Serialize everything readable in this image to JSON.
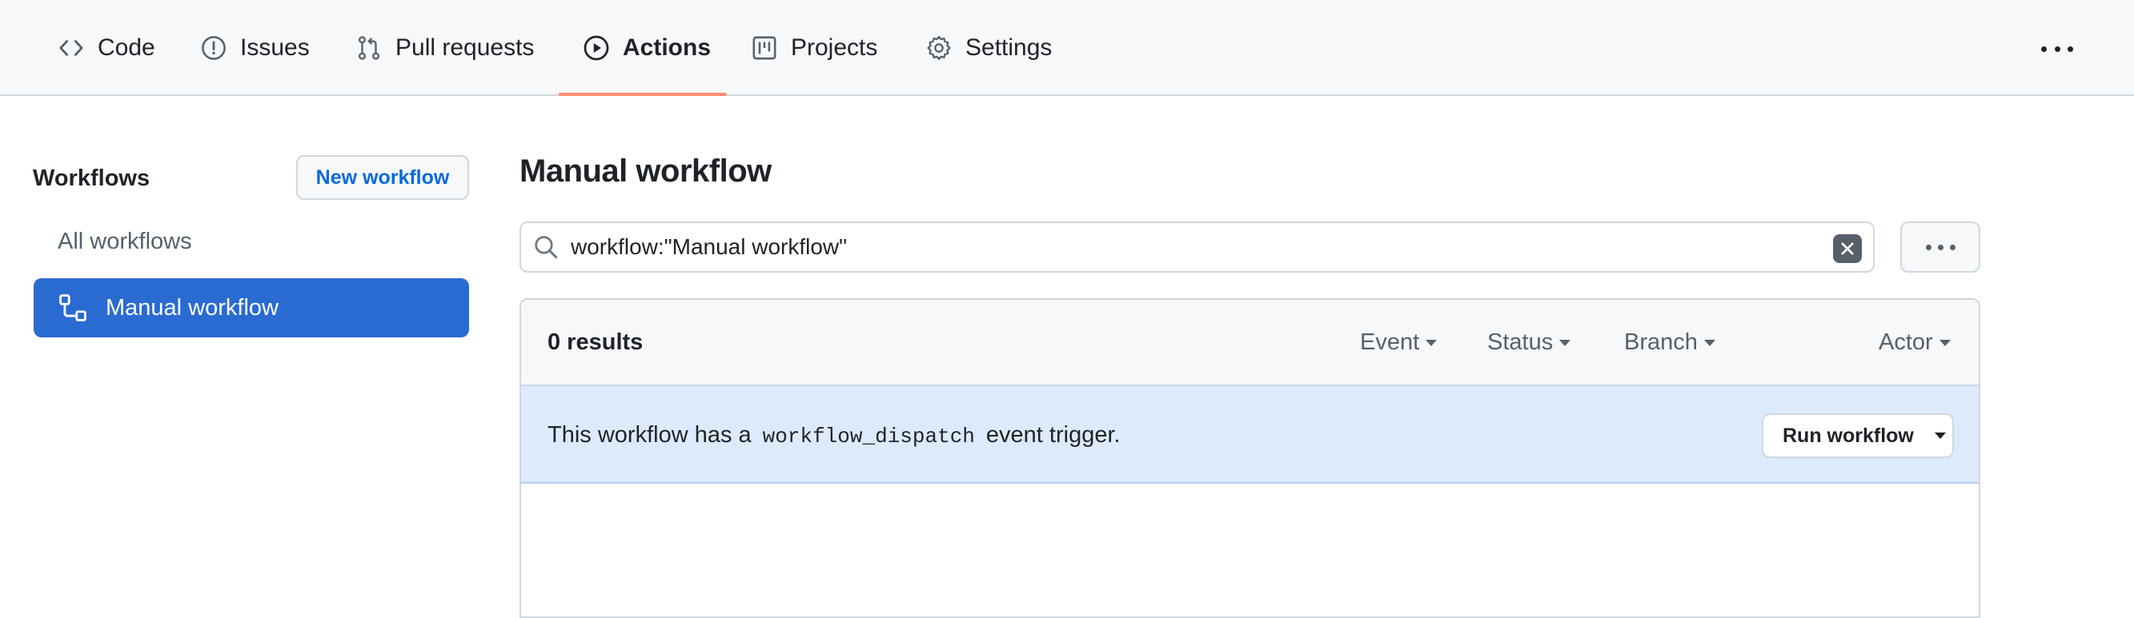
{
  "tabs": [
    {
      "label": "Code",
      "icon": "code-icon",
      "active": false
    },
    {
      "label": "Issues",
      "icon": "issue-opened-icon",
      "active": false
    },
    {
      "label": "Pull requests",
      "icon": "git-pull-request-icon",
      "active": false
    },
    {
      "label": "Actions",
      "icon": "play-icon",
      "active": true
    },
    {
      "label": "Projects",
      "icon": "project-icon",
      "active": false
    },
    {
      "label": "Settings",
      "icon": "gear-icon",
      "active": false
    }
  ],
  "sidebar": {
    "title": "Workflows",
    "new_workflow_label": "New workflow",
    "items": [
      {
        "label": "All workflows",
        "selected": false
      },
      {
        "label": "Manual workflow",
        "selected": true,
        "icon": "workflow-icon"
      }
    ]
  },
  "main": {
    "title": "Manual workflow",
    "search_value": "workflow:\"Manual workflow\"",
    "results_label": "0 results",
    "filters": [
      "Event",
      "Status",
      "Branch",
      "Actor"
    ],
    "notice": {
      "prefix": "This workflow has a",
      "code": "workflow_dispatch",
      "suffix": "event trigger."
    },
    "run_workflow_label": "Run workflow"
  },
  "colors": {
    "accent_underline": "#fd8c73",
    "selected_bg": "#2a6bd2",
    "link_blue": "#0969da",
    "notice_bg": "#ddeafc"
  }
}
